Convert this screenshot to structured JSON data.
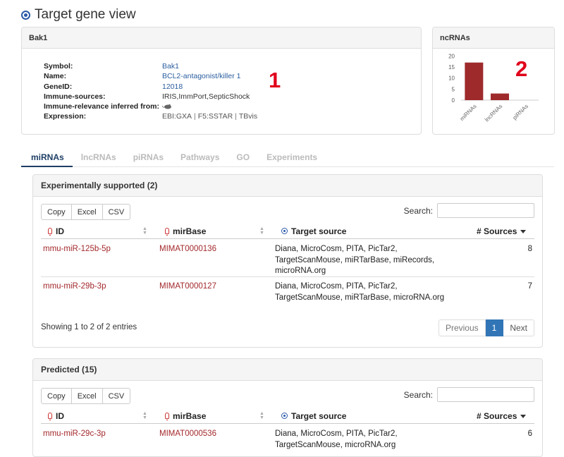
{
  "page": {
    "title": "Target gene view"
  },
  "gene": {
    "header": "Bak1",
    "fields": [
      {
        "key": "Symbol:",
        "value": "Bak1"
      },
      {
        "key": "Name:",
        "value": "BCL2-antagonist/killer 1"
      },
      {
        "key": "GeneID:",
        "value": "12018"
      },
      {
        "key": "Immune-sources:",
        "value": "IRIS,ImmPort,SepticShock"
      },
      {
        "key": "Immune-relevance inferred from:"
      },
      {
        "key": "Expression:",
        "links": [
          "EBI:GXA",
          "F5:SSTAR",
          "TBvis"
        ],
        "sep": "|"
      }
    ]
  },
  "annotations": [
    "1",
    "2"
  ],
  "ncrna": {
    "header": "ncRNAs",
    "colors": {
      "bar": "#9e2a2b"
    }
  },
  "chart_data": {
    "type": "bar",
    "categories": [
      "miRNAs",
      "lncRNAs",
      "piRNAs"
    ],
    "values": [
      17,
      3,
      0
    ],
    "yticks": [
      0,
      5,
      10,
      15,
      20
    ],
    "ylim": [
      0,
      22
    ]
  },
  "tabs": [
    {
      "label": "miRNAs",
      "active": true
    },
    {
      "label": "lncRNAs"
    },
    {
      "label": "piRNAs"
    },
    {
      "label": "Pathways"
    },
    {
      "label": "GO"
    },
    {
      "label": "Experiments"
    }
  ],
  "buttons": {
    "copy": "Copy",
    "excel": "Excel",
    "csv": "CSV"
  },
  "search_label": "Search:",
  "columns": {
    "id": "ID",
    "mirbase": "mirBase",
    "target_source": "Target source",
    "sources": "# Sources"
  },
  "experimental": {
    "title": "Experimentally supported (2)",
    "rows": [
      {
        "id": "mmu-miR-125b-5p",
        "mirbase": "MIMAT0000136",
        "source": "Diana, MicroCosm, PITA, PicTar2, TargetScanMouse, miRTarBase, miRecords, microRNA.org",
        "count": "8"
      },
      {
        "id": "mmu-miR-29b-3p",
        "mirbase": "MIMAT0000127",
        "source": "Diana, MicroCosm, PITA, PicTar2, TargetScanMouse, miRTarBase, microRNA.org",
        "count": "7"
      }
    ],
    "info": "Showing 1 to 2 of 2 entries",
    "pager": {
      "previous": "Previous",
      "page": "1",
      "next": "Next"
    }
  },
  "predicted": {
    "title": "Predicted (15)",
    "rows": [
      {
        "id": "mmu-miR-29c-3p",
        "mirbase": "MIMAT0000536",
        "source": "Diana, MicroCosm, PITA, PicTar2, TargetScanMouse, microRNA.org",
        "count": "6"
      }
    ]
  }
}
